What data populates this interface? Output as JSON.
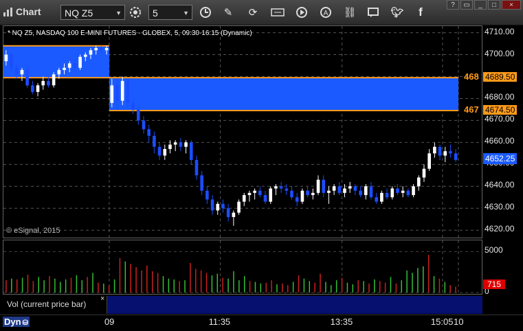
{
  "toolbar": {
    "title": "Chart",
    "symbol": "NQ Z5",
    "interval": "5"
  },
  "chart": {
    "title": "* NQ Z5, NASDAQ 100 E-MINI FUTURES - GLOBEX, 5, 09:30-16:15 (Dynamic)",
    "copyright": "© eSignal, 2015"
  },
  "chart_data": {
    "type": "candlestick",
    "ylim": [
      4616,
      4713
    ],
    "y_ticks": [
      "4710.00",
      "4700.00",
      "4690.00",
      "4680.00",
      "4670.00",
      "4660.00",
      "4650.00",
      "4640.00",
      "4630.00",
      "4620.00"
    ],
    "x_ticks": [
      "09",
      "11:35",
      "13:35",
      "15:05",
      "10"
    ],
    "last_price": "4652.25",
    "levels": [
      {
        "label": "468",
        "value": "4689.50"
      },
      {
        "label": "467",
        "value": "4674.50"
      }
    ],
    "zones": [
      {
        "from": 4689.5,
        "to": 4704.0,
        "bars": [
          0,
          20
        ]
      },
      {
        "from": 4674.5,
        "to": 4689.5,
        "bars": [
          20,
          86
        ]
      }
    ],
    "candles": [
      [
        4697,
        4702,
        4695,
        4700
      ],
      [
        4700,
        4701,
        4692,
        4694
      ],
      [
        4694,
        4696,
        4689,
        4691
      ],
      [
        4691,
        4694,
        4688,
        4693
      ],
      [
        4693,
        4695,
        4685,
        4686
      ],
      [
        4686,
        4688,
        4682,
        4683
      ],
      [
        4683,
        4687,
        4681,
        4686
      ],
      [
        4686,
        4690,
        4684,
        4688
      ],
      [
        4688,
        4690,
        4685,
        4686
      ],
      [
        4686,
        4692,
        4685,
        4691
      ],
      [
        4691,
        4694,
        4689,
        4693
      ],
      [
        4693,
        4696,
        4691,
        4694
      ],
      [
        4694,
        4697,
        4692,
        4696
      ],
      [
        4696,
        4698,
        4693,
        4694
      ],
      [
        4694,
        4700,
        4693,
        4699
      ],
      [
        4699,
        4701,
        4697,
        4700
      ],
      [
        4700,
        4703,
        4698,
        4702
      ],
      [
        4702,
        4704,
        4700,
        4703
      ],
      [
        4703,
        4704,
        4701,
        4702
      ],
      [
        4702,
        4704,
        4700,
        4703
      ],
      [
        4678,
        4689,
        4676,
        4686
      ],
      [
        4686,
        4689,
        4675,
        4679
      ],
      [
        4679,
        4690,
        4677,
        4688
      ],
      [
        4688,
        4689,
        4676,
        4678
      ],
      [
        4678,
        4680,
        4673,
        4675
      ],
      [
        4675,
        4676,
        4668,
        4670
      ],
      [
        4670,
        4672,
        4664,
        4666
      ],
      [
        4666,
        4668,
        4660,
        4663
      ],
      [
        4663,
        4665,
        4655,
        4658
      ],
      [
        4658,
        4660,
        4652,
        4654
      ],
      [
        4654,
        4659,
        4652,
        4657
      ],
      [
        4657,
        4661,
        4655,
        4659
      ],
      [
        4659,
        4661,
        4656,
        4660
      ],
      [
        4660,
        4662,
        4656,
        4658
      ],
      [
        4658,
        4661,
        4655,
        4660
      ],
      [
        4660,
        4661,
        4650,
        4652
      ],
      [
        4652,
        4654,
        4643,
        4645
      ],
      [
        4645,
        4647,
        4636,
        4638
      ],
      [
        4638,
        4640,
        4632,
        4634
      ],
      [
        4634,
        4636,
        4627,
        4629
      ],
      [
        4629,
        4633,
        4627,
        4632
      ],
      [
        4632,
        4634,
        4628,
        4630
      ],
      [
        4630,
        4632,
        4624,
        4626
      ],
      [
        4626,
        4629,
        4622,
        4628
      ],
      [
        4628,
        4634,
        4627,
        4633
      ],
      [
        4633,
        4637,
        4631,
        4636
      ],
      [
        4636,
        4638,
        4633,
        4637
      ],
      [
        4637,
        4639,
        4634,
        4638
      ],
      [
        4638,
        4640,
        4635,
        4636
      ],
      [
        4636,
        4638,
        4632,
        4633
      ],
      [
        4633,
        4640,
        4632,
        4639
      ],
      [
        4639,
        4641,
        4636,
        4640
      ],
      [
        4640,
        4642,
        4637,
        4639
      ],
      [
        4639,
        4641,
        4636,
        4638
      ],
      [
        4638,
        4640,
        4634,
        4635
      ],
      [
        4635,
        4637,
        4631,
        4633
      ],
      [
        4633,
        4639,
        4632,
        4638
      ],
      [
        4638,
        4640,
        4635,
        4636
      ],
      [
        4636,
        4639,
        4634,
        4637
      ],
      [
        4637,
        4645,
        4636,
        4643
      ],
      [
        4643,
        4645,
        4635,
        4637
      ],
      [
        4637,
        4640,
        4632,
        4638
      ],
      [
        4638,
        4641,
        4636,
        4640
      ],
      [
        4640,
        4642,
        4636,
        4637
      ],
      [
        4637,
        4641,
        4635,
        4639
      ],
      [
        4639,
        4642,
        4637,
        4640
      ],
      [
        4640,
        4641,
        4636,
        4638
      ],
      [
        4638,
        4640,
        4635,
        4636
      ],
      [
        4636,
        4641,
        4634,
        4640
      ],
      [
        4640,
        4642,
        4634,
        4635
      ],
      [
        4635,
        4637,
        4632,
        4633
      ],
      [
        4633,
        4638,
        4632,
        4637
      ],
      [
        4637,
        4639,
        4634,
        4635
      ],
      [
        4635,
        4640,
        4634,
        4639
      ],
      [
        4639,
        4641,
        4636,
        4637
      ],
      [
        4637,
        4640,
        4635,
        4638
      ],
      [
        4638,
        4639,
        4635,
        4636
      ],
      [
        4636,
        4641,
        4635,
        4640
      ],
      [
        4640,
        4645,
        4638,
        4644
      ],
      [
        4644,
        4650,
        4642,
        4648
      ],
      [
        4648,
        4657,
        4647,
        4655
      ],
      [
        4655,
        4660,
        4653,
        4658
      ],
      [
        4658,
        4659,
        4652,
        4654
      ],
      [
        4654,
        4658,
        4651,
        4656
      ],
      [
        4656,
        4659,
        4653,
        4655
      ],
      [
        4655,
        4657,
        4651,
        4652
      ]
    ],
    "volume_ticks": [
      "5000",
      "0"
    ],
    "volume_last": "715",
    "volume": [
      [
        1500,
        "r"
      ],
      [
        1700,
        "g"
      ],
      [
        1600,
        "r"
      ],
      [
        1800,
        "g"
      ],
      [
        2200,
        "r"
      ],
      [
        1400,
        "r"
      ],
      [
        1900,
        "g"
      ],
      [
        1500,
        "g"
      ],
      [
        2000,
        "r"
      ],
      [
        1700,
        "g"
      ],
      [
        1300,
        "g"
      ],
      [
        1600,
        "g"
      ],
      [
        1800,
        "r"
      ],
      [
        2100,
        "g"
      ],
      [
        1500,
        "g"
      ],
      [
        1900,
        "r"
      ],
      [
        2400,
        "g"
      ],
      [
        1200,
        "r"
      ],
      [
        1100,
        "g"
      ],
      [
        900,
        "r"
      ],
      [
        1600,
        "g"
      ],
      [
        4200,
        "r"
      ],
      [
        3800,
        "g"
      ],
      [
        3500,
        "r"
      ],
      [
        3100,
        "r"
      ],
      [
        2700,
        "r"
      ],
      [
        3300,
        "r"
      ],
      [
        2600,
        "r"
      ],
      [
        2400,
        "r"
      ],
      [
        2000,
        "g"
      ],
      [
        1700,
        "g"
      ],
      [
        1600,
        "g"
      ],
      [
        1400,
        "r"
      ],
      [
        1500,
        "g"
      ],
      [
        3600,
        "r"
      ],
      [
        2900,
        "r"
      ],
      [
        2700,
        "r"
      ],
      [
        2400,
        "r"
      ],
      [
        2100,
        "g"
      ],
      [
        2300,
        "g"
      ],
      [
        1800,
        "r"
      ],
      [
        1700,
        "g"
      ],
      [
        2600,
        "g"
      ],
      [
        1500,
        "g"
      ],
      [
        2000,
        "g"
      ],
      [
        1400,
        "r"
      ],
      [
        1300,
        "g"
      ],
      [
        1100,
        "g"
      ],
      [
        1200,
        "r"
      ],
      [
        1500,
        "r"
      ],
      [
        1000,
        "g"
      ],
      [
        1100,
        "r"
      ],
      [
        900,
        "r"
      ],
      [
        1300,
        "g"
      ],
      [
        2100,
        "r"
      ],
      [
        1700,
        "g"
      ],
      [
        1400,
        "g"
      ],
      [
        1200,
        "r"
      ],
      [
        2300,
        "r"
      ],
      [
        1300,
        "g"
      ],
      [
        900,
        "g"
      ],
      [
        1500,
        "g"
      ],
      [
        1800,
        "r"
      ],
      [
        1200,
        "g"
      ],
      [
        1000,
        "g"
      ],
      [
        1500,
        "r"
      ],
      [
        1400,
        "g"
      ],
      [
        1100,
        "r"
      ],
      [
        1600,
        "g"
      ],
      [
        1400,
        "r"
      ],
      [
        1200,
        "r"
      ],
      [
        1900,
        "g"
      ],
      [
        1100,
        "r"
      ],
      [
        1500,
        "g"
      ],
      [
        2700,
        "g"
      ],
      [
        2400,
        "g"
      ],
      [
        3000,
        "g"
      ],
      [
        3200,
        "g"
      ],
      [
        4600,
        "r"
      ],
      [
        2000,
        "g"
      ],
      [
        1700,
        "r"
      ],
      [
        1300,
        "g"
      ],
      [
        900,
        "r"
      ],
      [
        715,
        "r"
      ]
    ]
  },
  "status_bar": {
    "study_label": "Vol (current price bar)",
    "close_glyph": "×",
    "mode": "Dyn"
  },
  "colors": {
    "up": "#ffffff",
    "down": "#1a4dff",
    "zone": "#1a5aff",
    "level": "#ff9a1a",
    "vol_up": "#35c035",
    "vol_down": "#cc2020"
  },
  "icons": [
    "chart-icon",
    "settings-icon",
    "clock-icon",
    "pencil-icon",
    "refresh-icon",
    "get-icon",
    "play-icon",
    "a-icon",
    "link-icon",
    "comment-icon",
    "twitter-icon",
    "facebook-icon"
  ]
}
